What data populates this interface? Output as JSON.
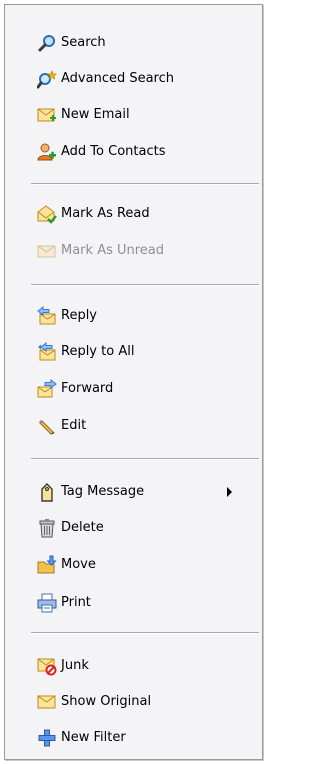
{
  "menu": {
    "groups": [
      [
        {
          "label": "Search",
          "icon": "search-icon"
        },
        {
          "label": "Advanced Search",
          "icon": "advanced-search-icon"
        },
        {
          "label": "New Email",
          "icon": "new-email-icon"
        },
        {
          "label": "Add To Contacts",
          "icon": "add-contact-icon"
        }
      ],
      [
        {
          "label": "Mark As Read",
          "icon": "mark-read-icon"
        },
        {
          "label": "Mark As Unread",
          "icon": "mark-unread-icon",
          "disabled": true
        }
      ],
      [
        {
          "label": "Reply",
          "icon": "reply-icon"
        },
        {
          "label": "Reply to All",
          "icon": "reply-all-icon"
        },
        {
          "label": "Forward",
          "icon": "forward-icon"
        },
        {
          "label": "Edit",
          "icon": "pencil-icon"
        }
      ],
      [
        {
          "label": "Tag Message",
          "icon": "tag-icon",
          "submenu": true
        },
        {
          "label": "Delete",
          "icon": "trash-icon"
        },
        {
          "label": "Move",
          "icon": "move-folder-icon"
        },
        {
          "label": "Print",
          "icon": "printer-icon"
        }
      ],
      [
        {
          "label": "Junk",
          "icon": "junk-icon"
        },
        {
          "label": "Show Original",
          "icon": "envelope-icon"
        },
        {
          "label": "New Filter",
          "icon": "add-filter-icon"
        }
      ]
    ]
  },
  "colors": {
    "menu_background": "#f4f4f6",
    "border": "#9a9a9a",
    "disabled_text": "#8f8f8f",
    "envelope": "#f2c14e",
    "reply_blue": "#3c78d8"
  }
}
